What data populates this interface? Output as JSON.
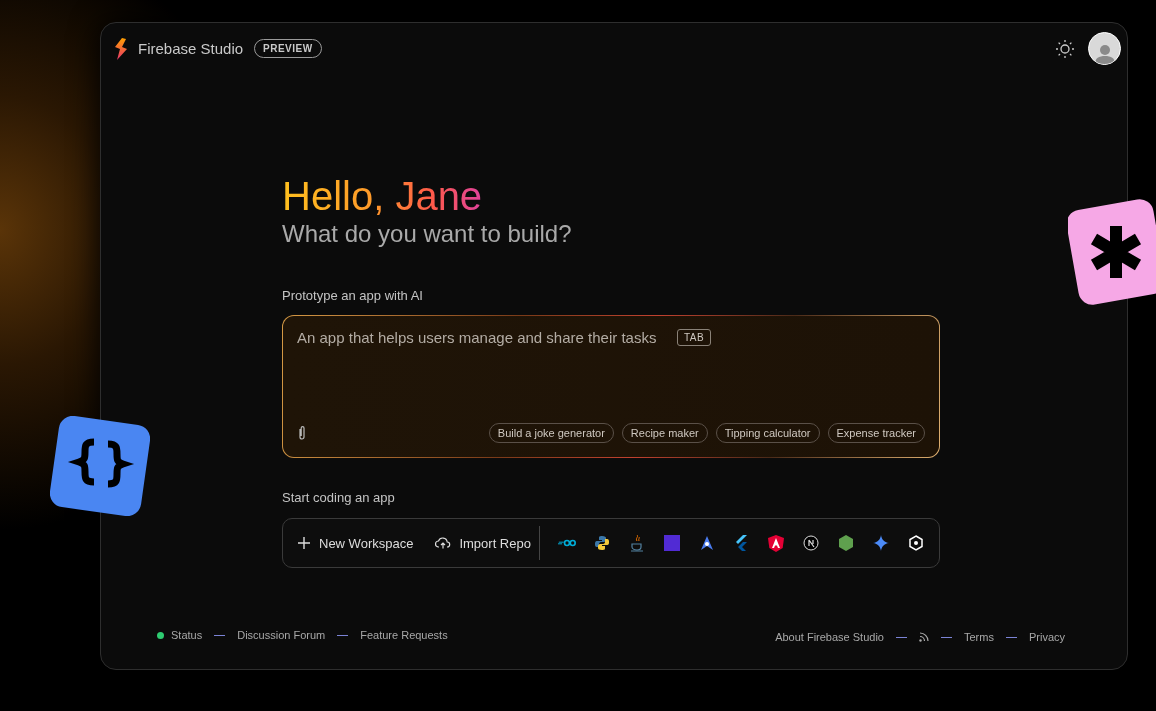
{
  "header": {
    "title": "Firebase Studio",
    "badge": "PREVIEW"
  },
  "greeting": {
    "hello": "Hello, Jane",
    "subtitle": "What do you want to build?"
  },
  "prototype": {
    "label": "Prototype an app with AI",
    "placeholder": "An app that helps users manage and share their tasks",
    "key_hint": "TAB",
    "suggestions": [
      "Build a joke generator",
      "Recipe maker",
      "Tipping calculator",
      "Expense tracker"
    ]
  },
  "coding": {
    "label": "Start coding an app",
    "actions": [
      {
        "kind": "plus",
        "label": "New Workspace"
      },
      {
        "kind": "upload",
        "label": "Import Repo"
      }
    ],
    "templates": [
      {
        "kind": "go"
      },
      {
        "kind": "python"
      },
      {
        "kind": "java"
      },
      {
        "kind": "dotnet"
      },
      {
        "kind": "astro"
      },
      {
        "kind": "flutter"
      },
      {
        "kind": "angular"
      },
      {
        "kind": "next"
      },
      {
        "kind": "node"
      },
      {
        "kind": "gemini"
      },
      {
        "kind": "hex"
      }
    ]
  },
  "footer": {
    "left": [
      {
        "kind": "status",
        "label": "Status",
        "color": "#2ecc71"
      },
      {
        "kind": "link",
        "label": "Discussion Forum"
      },
      {
        "kind": "link",
        "label": "Feature Requests"
      }
    ],
    "right": [
      {
        "kind": "link",
        "label": "About Firebase Studio"
      },
      {
        "kind": "rss"
      },
      {
        "kind": "link",
        "label": "Terms"
      },
      {
        "kind": "link",
        "label": "Privacy"
      }
    ]
  }
}
